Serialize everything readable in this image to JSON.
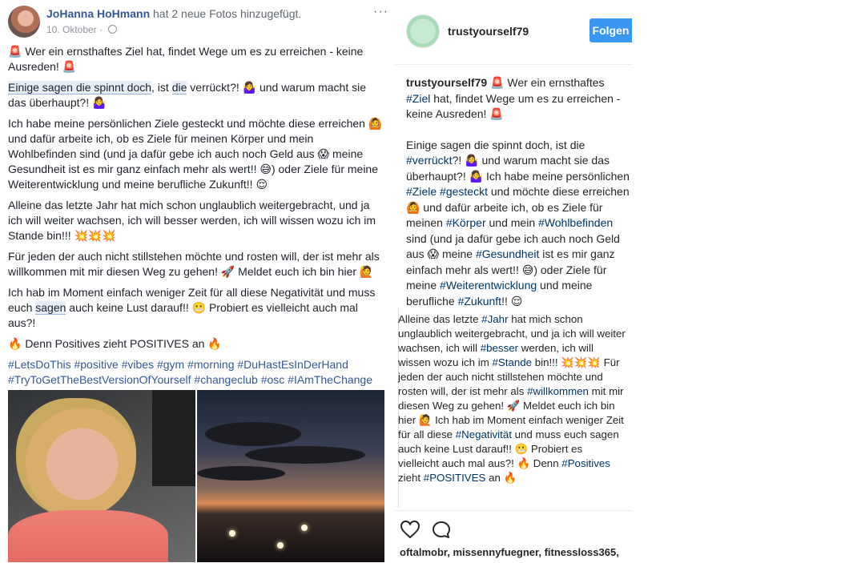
{
  "fb": {
    "author": "JoHanna HoHmann",
    "action": " hat 2 neue Fotos hinzugefügt.",
    "date": "10. Oktober",
    "dot": " · ",
    "more": "···",
    "p1": "🚨 Wer ein ernsthaftes Ziel hat, findet Wege um es zu erreichen - keine Ausreden! 🚨",
    "p2a": "Einige sagen die spinnt doch",
    "p2b": ", ist ",
    "p2c": "die",
    "p2d": " verrückt?! 🤷‍♀️ und warum macht sie das überhaupt?! 🤷‍♀️",
    "p3": "Ich habe meine persönlichen Ziele gesteckt und möchte diese erreichen 🙆 und dafür arbeite ich, ob es Ziele für meinen Körper und mein Wohlbefinden sind (und ja dafür gebe ich auch noch Geld aus 😱 meine Gesundheit ist es mir ganz einfach mehr als wert!! 😅) oder Ziele für meine Weiterentwicklung und meine berufliche Zukunft!! 😌",
    "p4": "Alleine das letzte Jahr hat mich schon unglaublich weitergebracht, und ja ich will weiter wachsen, ich will besser werden, ich will wissen wozu ich im Stande bin!!! 💥💥💥",
    "p5": "Für jeden der auch nicht stillstehen möchte und rosten will, der ist mehr als willkommen mit mir diesen Weg zu gehen! 🚀 Meldet euch ich bin hier 🙋",
    "p6a": "Ich hab im Moment einfach weniger Zeit für all diese Negativität und muss euch ",
    "p6b": "sagen",
    "p6c": " auch keine Lust darauf!! 😬 Probiert es vielleicht auch mal aus?!",
    "p7": "🔥 Denn Positives zieht POSITIVES an 🔥",
    "tags1": "#LetsDoThis #positive #vibes #gym #morning #DuHastEsInDerHand",
    "tags2": "#TryToGetTheBestVersionOfYourself #changeclub #osc #IAmTheChange"
  },
  "ig": {
    "username": "trustyourself79",
    "follow_label": "Folgen",
    "caption": {
      "user": "trustyourself79",
      "s1": " 🚨 Wer ein ernsthaftes ",
      "t_ziel": "#Ziel",
      "s2": " hat, findet Wege um es zu erreichen - keine Ausreden! 🚨",
      "s3": "Einige sagen die spinnt doch, ist die ",
      "t_verrueckt": "#verrückt",
      "s4": "?! 🤷‍♀️ und warum macht sie das überhaupt?! 🤷‍♀️ Ich habe meine persönlichen ",
      "t_ziele": "#Ziele",
      "s5": " ",
      "t_gesteckt": "#gesteckt",
      "s6": " und möchte diese erreichen 🙆 und dafür arbeite ich, ob es Ziele für meinen ",
      "t_koerper": "#Körper",
      "s7": " und mein ",
      "t_wohl": "#Wohlbefinden",
      "s8": " sind (und ja dafür gebe ich auch noch Geld aus 😱 meine ",
      "t_gesund": "#Gesundheit",
      "s9": " ist es mir ganz einfach mehr als wert!! 😅) oder Ziele für meine ",
      "t_weiter": "#Weiterentwicklung",
      "s10": " und meine berufliche ",
      "t_zukunft": "#Zukunft",
      "s11": "!! 😌"
    },
    "cont": {
      "c1": "Alleine das letzte ",
      "t_jahr": "#Jahr",
      "c2": " hat mich schon unglaublich weitergebracht, und ja ich will weiter wachsen, ich will ",
      "t_besser": "#besser",
      "c3": " werden, ich will wissen wozu ich im ",
      "t_stande": "#Stande",
      "c4": " bin!!! 💥💥💥 Für jeden der auch nicht stillstehen möchte und rosten will, der ist mehr als ",
      "t_willkommen": "#willkommen",
      "c5": " mit mir diesen Weg zu gehen! 🚀 Meldet euch ich bin hier 🙋 Ich hab im Moment einfach weniger Zeit für all diese ",
      "t_negativ": "#Negativität",
      "c6": " und muss euch sagen auch keine Lust darauf!! 😬 Probiert es vielleicht auch mal aus?! 🔥 Denn ",
      "t_positives": "#Positives",
      "c7": " zieht ",
      "t_POSITIVES": "#POSITIVES",
      "c8": " an 🔥"
    },
    "likes": "oftalmobr, missennyfuegner, fitnessloss365,"
  },
  "colors": {
    "fb_link": "#365899",
    "ig_link": "#003569",
    "ig_follow": "#3897f0"
  }
}
